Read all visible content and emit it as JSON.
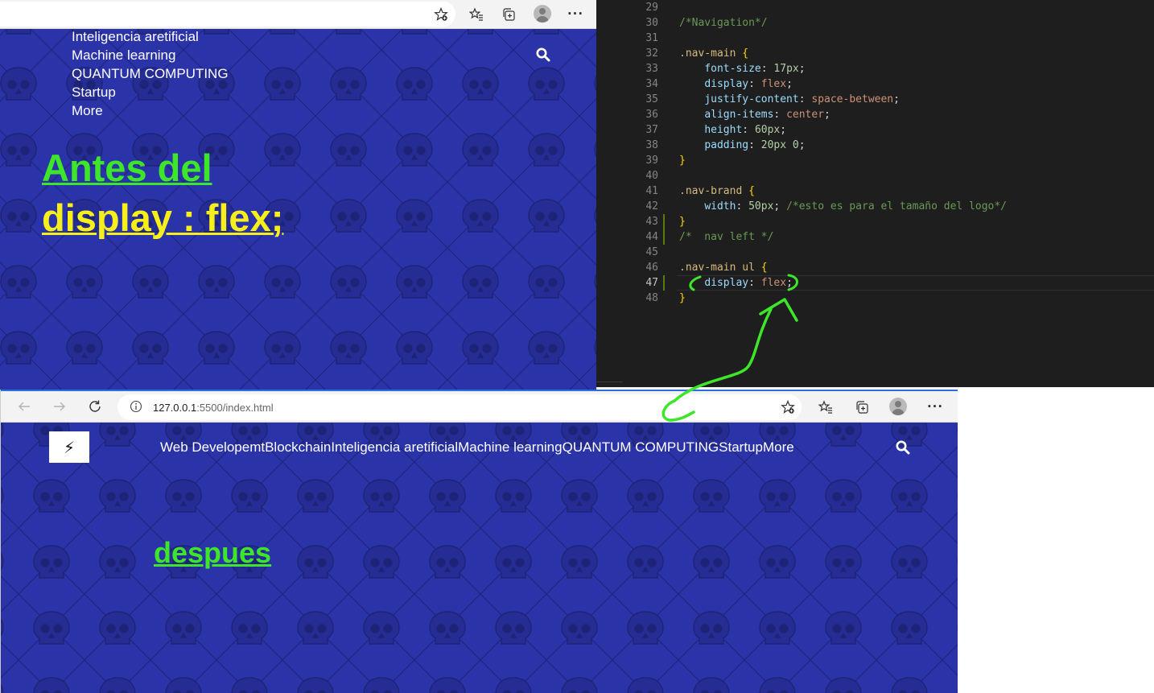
{
  "top_browser": {
    "nav_items": [
      "Inteligencia aretificial",
      "Machine learning",
      "QUANTUM COMPUTING",
      "Startup",
      "More"
    ],
    "heading_line1": "Antes del",
    "heading_line2": "display : flex;",
    "toolbar_icons": [
      "favorite-add-icon",
      "favorites-icon",
      "collections-icon",
      "profile-icon",
      "more-icon"
    ]
  },
  "editor": {
    "lines": [
      {
        "num": "29",
        "code": ""
      },
      {
        "num": "30",
        "code": "/*Navigation*/"
      },
      {
        "num": "31",
        "code": ""
      },
      {
        "num": "32",
        "code": ".nav-main {"
      },
      {
        "num": "33",
        "code": "    font-size: 17px;"
      },
      {
        "num": "34",
        "code": "    display: flex;"
      },
      {
        "num": "35",
        "code": "    justify-content: space-between;"
      },
      {
        "num": "36",
        "code": "    align-items: center;"
      },
      {
        "num": "37",
        "code": "    height: 60px;"
      },
      {
        "num": "38",
        "code": "    padding: 20px 0;"
      },
      {
        "num": "39",
        "code": "}"
      },
      {
        "num": "40",
        "code": ""
      },
      {
        "num": "41",
        "code": ".nav-brand {"
      },
      {
        "num": "42",
        "code": "    width: 50px; /*esto es para el tamaño del logo*/"
      },
      {
        "num": "43",
        "code": "}"
      },
      {
        "num": "44",
        "code": "/*  nav left */"
      },
      {
        "num": "45",
        "code": ""
      },
      {
        "num": "46",
        "code": ".nav-main ul {"
      },
      {
        "num": "47",
        "code": "    display: flex;"
      },
      {
        "num": "48",
        "code": "}"
      }
    ],
    "active_line": "47"
  },
  "bottom_browser": {
    "url_host": "127.0.0.1",
    "url_rest": ":5500/index.html",
    "logo_glyph": "⚡",
    "nav_items": [
      "Web Developemt",
      "Blockchain",
      "Inteligencia aretificial",
      "Machine learning",
      "QUANTUM COMPUTING",
      "Startup",
      "More"
    ],
    "heading": "despues",
    "toolbar_icons": [
      "back-icon",
      "forward-icon",
      "refresh-icon",
      "info-icon",
      "favorite-add-icon",
      "favorites-icon",
      "collections-icon",
      "profile-icon",
      "more-icon"
    ]
  },
  "colors": {
    "page_bg": "#2b33a8",
    "annotation_green": "#3ee62a",
    "heading_yellow": "#f7ef19",
    "editor_bg": "#1e1e1e"
  }
}
